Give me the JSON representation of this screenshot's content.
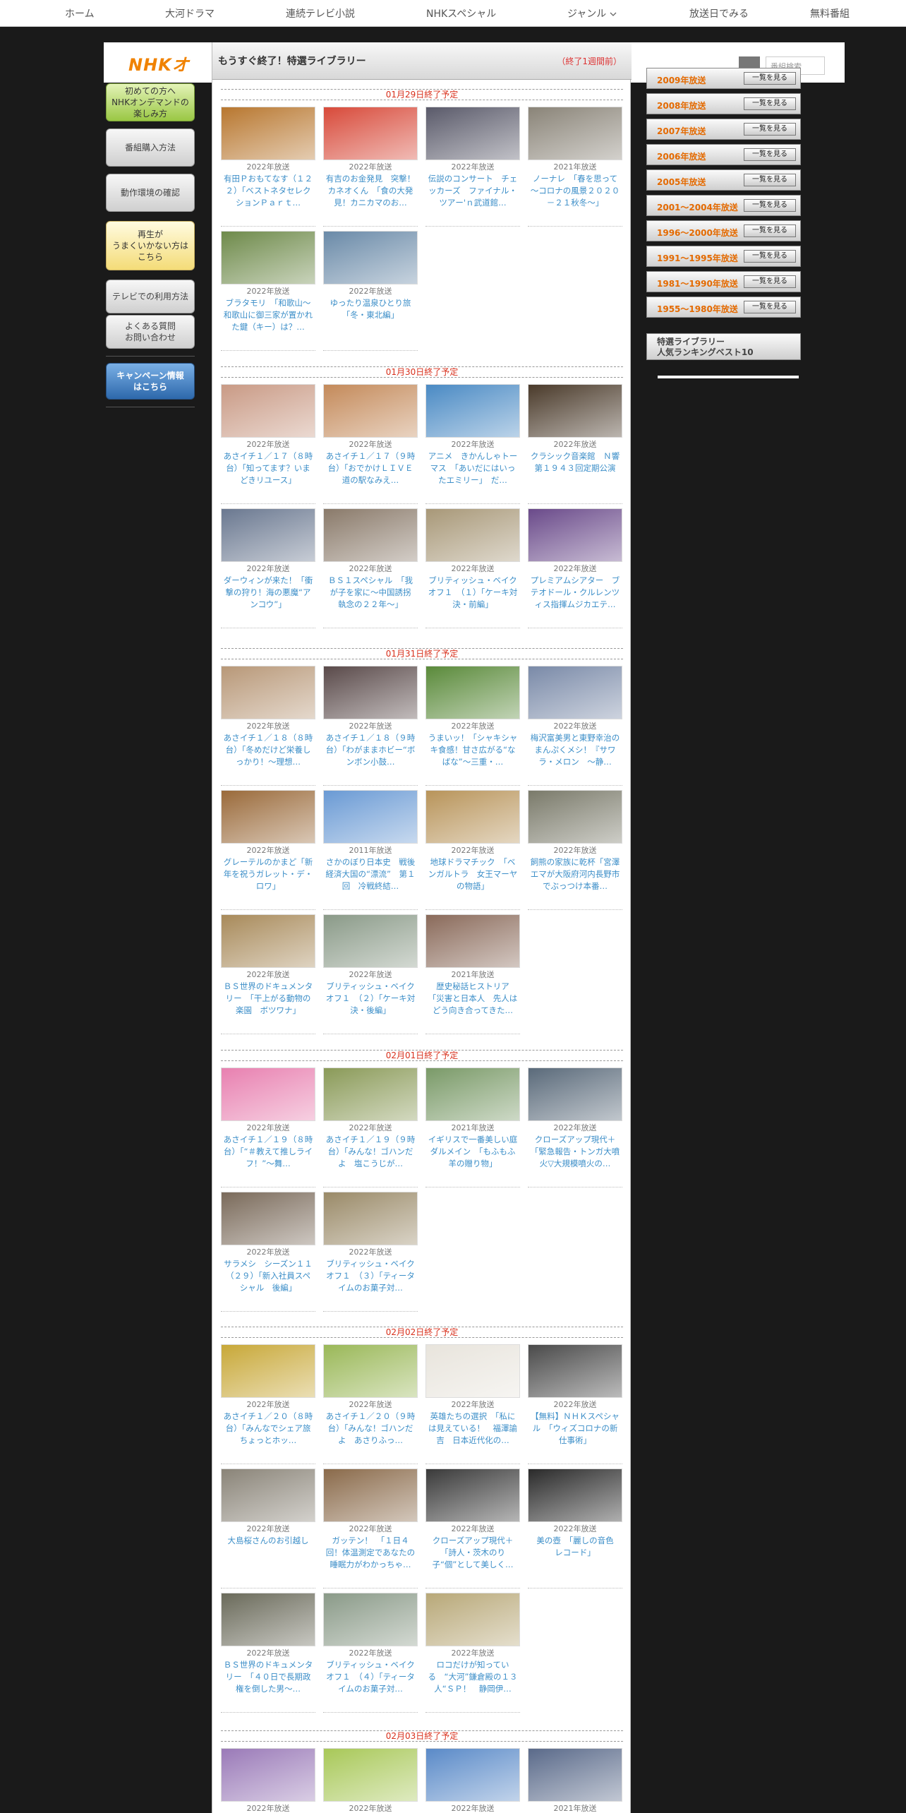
{
  "nav": [
    "ホーム",
    "大河ドラマ",
    "連続テレビ小説",
    "NHKスペシャル",
    "ジャンル",
    "放送日でみる",
    "無料番組"
  ],
  "nav_genre_icon": "chevron-down-icon",
  "header": {
    "logo": "NHKオ",
    "search_placeholder": "番組検索"
  },
  "library": {
    "title": "もうすぐ終了！特選ライブラリー",
    "note": "（終了1週間前）"
  },
  "left": {
    "beginner": "初めての方へ\nNHKオンデマンドの\n楽しみ方",
    "purchase": "番組購入方法",
    "environment": "動作環境の確認",
    "trouble": "再生が\nうまくいかない方は\nこちら",
    "tv": "テレビでの利用方法",
    "faq": "よくある質問\nお問い合わせ",
    "campaign": "キャンペーン情報\nはこちら"
  },
  "right": {
    "view_button": "一覧を見る",
    "years": [
      "2009年放送",
      "2008年放送",
      "2007年放送",
      "2006年放送",
      "2005年放送",
      "2001～2004年放送",
      "1996～2000年放送",
      "1991～1995年放送",
      "1981～1990年放送",
      "1955～1980年放送"
    ],
    "ranking": "特選ライブラリー\n人気ランキングベスト10"
  },
  "sections": [
    {
      "date": "01月29日終了予定",
      "items": [
        {
          "year": "2022年放送",
          "title": "有田Ｐおもてなす（１２２）「ベストネタセレクションＰａｒｔ…",
          "color": "#b8772f"
        },
        {
          "year": "2022年放送",
          "title": "有吉のお金発見　突撃！カネオくん　「食の大発見！カニカマのお…",
          "color": "#d84a3a"
        },
        {
          "year": "2022年放送",
          "title": "伝説のコンサート　チェッカーズ　ファイナル・ツアー'ｎ武道館…",
          "color": "#5a5a6a"
        },
        {
          "year": "2021年放送",
          "title": "ノーナレ　「春を思って～コロナの風景２０２０－２１秋冬～」",
          "color": "#8a8478"
        },
        {
          "year": "2022年放送",
          "title": "ブラタモリ　「和歌山～和歌山に御三家が置かれた鍵（キー）は？…",
          "color": "#6e8a4a"
        },
        {
          "year": "2022年放送",
          "title": "ゆったり温泉ひとり旅　「冬・東北編」",
          "color": "#6a8aa8"
        }
      ]
    },
    {
      "date": "01月30日終了予定",
      "items": [
        {
          "year": "2022年放送",
          "title": "あさイチ１／１７（８時台）「知ってます？いまどきリユース」",
          "color": "#c99a85"
        },
        {
          "year": "2022年放送",
          "title": "あさイチ１／１７（９時台）「おでかけＬＩＶＥ　道の駅なみえ…",
          "color": "#c48a5a"
        },
        {
          "year": "2022年放送",
          "title": "アニメ　きかんしゃトーマス　「あいだにはいったエミリー」　だ…",
          "color": "#4a8ac4"
        },
        {
          "year": "2022年放送",
          "title": "クラシック音楽館　Ｎ響第１９４３回定期公演",
          "color": "#4a3a2a"
        },
        {
          "year": "2022年放送",
          "title": "ダーウィンが来た！「衝撃の狩り！海の悪魔“アンコウ”」",
          "color": "#6a7890"
        },
        {
          "year": "2022年放送",
          "title": "ＢＳ１スペシャル　「我が子を家に～中国誘拐　執念の２２年～」",
          "color": "#8a7a6a"
        },
        {
          "year": "2022年放送",
          "title": "ブリティッシュ・ベイクオフ１　（１）「ケーキ対決・前編」",
          "color": "#a89878"
        },
        {
          "year": "2022年放送",
          "title": "プレミアムシアター　ブテオドール・クルレンツィス指揮ムジカエテ…",
          "color": "#6a4a8a"
        }
      ]
    },
    {
      "date": "01月31日終了予定",
      "items": [
        {
          "year": "2022年放送",
          "title": "あさイチ１／１８（８時台）「冬めだけど栄養しっかり！～理想…",
          "color": "#b89878"
        },
        {
          "year": "2022年放送",
          "title": "あさイチ１／１８（９時台）「わがままホビー“ボンボン小鼓…",
          "color": "#5a4a4a"
        },
        {
          "year": "2022年放送",
          "title": "うまいッ！「シャキシャキ食感！甘さ広がる“なばな”～三重・…",
          "color": "#5a8a3a"
        },
        {
          "year": "2022年放送",
          "title": "梅沢富美男と東野幸治のまんぷくメシ！『サワラ・メロン　～静…",
          "color": "#7a8aa8"
        },
        {
          "year": "2022年放送",
          "title": "グレーテルのかまど「新年を祝うガレット・デ・ロワ」",
          "color": "#9a6a3a"
        },
        {
          "year": "2011年放送",
          "title": "さかのぼり日本史　戦後　経済大国の“漂流”　第１回　冷戦終結…",
          "color": "#6a9ad4"
        },
        {
          "year": "2022年放送",
          "title": "地球ドラマチック　「ベンガルトラ　女王マーヤの物語」",
          "color": "#b8945a"
        },
        {
          "year": "2022年放送",
          "title": "飼熊の家族に乾杯「宮澤エマが大阪府河内長野市でぶっつけ本番…",
          "color": "#7a7a6a"
        },
        {
          "year": "2022年放送",
          "title": "ＢＳ世界のドキュメンタリー　「干上がる動物の楽園　ボツワナ」",
          "color": "#a88a5a"
        },
        {
          "year": "2022年放送",
          "title": "ブリティッシュ・ベイクオフ１　（２）「ケーキ対決・後編」",
          "color": "#8a9a88"
        },
        {
          "year": "2021年放送",
          "title": "歴史秘話ヒストリア　「災害と日本人　先人はどう向き合ってきた…",
          "color": "#8a6a5a"
        }
      ]
    },
    {
      "date": "02月01日終了予定",
      "items": [
        {
          "year": "2022年放送",
          "title": "あさイチ１／１９（８時台）「“＃教えて推しライフ！”～舞…",
          "color": "#e880b0"
        },
        {
          "year": "2022年放送",
          "title": "あさイチ１／１９（９時台）「みんな！ゴハンだよ　塩こうじが…",
          "color": "#8a9a58"
        },
        {
          "year": "2021年放送",
          "title": "イギリスで一番美しい庭　ダルメイン　「もふもふ羊の贈り物」",
          "color": "#7a9a68"
        },
        {
          "year": "2022年放送",
          "title": "クローズアップ現代＋「緊急報告・トンガ大噴火▽大規模噴火の…",
          "color": "#5a6a7a"
        },
        {
          "year": "2022年放送",
          "title": "サラメシ　シーズン１１　（２９）「新入社員スペシャル　後編」",
          "color": "#7a6a5a"
        },
        {
          "year": "2022年放送",
          "title": "ブリティッシュ・ベイクオフ１　（３）「ティータイムのお菓子対…",
          "color": "#9a8a68"
        }
      ]
    },
    {
      "date": "02月02日終了予定",
      "items": [
        {
          "year": "2022年放送",
          "title": "あさイチ１／２０（８時台）「みんなでシェア旅　ちょっとホッ…",
          "color": "#c8a838"
        },
        {
          "year": "2022年放送",
          "title": "あさイチ１／２０（９時台）「みんな！ゴハンだよ　あさりふっ…",
          "color": "#9ab858"
        },
        {
          "year": "2022年放送",
          "title": "英雄たちの選択　「私には見えている！　福澤諭吉　日本近代化の…",
          "color": "#e8e4dc"
        },
        {
          "year": "2022年放送",
          "title": "【無料】ＮＨＫスペシャル　「ウィズコロナの新仕事術」",
          "color": "#4a4a4a"
        },
        {
          "year": "2022年放送",
          "title": "大島桜さんのお引越し",
          "color": "#8a8478"
        },
        {
          "year": "2022年放送",
          "title": "ガッテン！　「１日４回！体温測定であなたの睡眠力がわかっちゃ…",
          "color": "#8a6a4a"
        },
        {
          "year": "2022年放送",
          "title": "クローズアップ現代＋「詩人・茨木のり子“個”として美しく…",
          "color": "#3a3a3a"
        },
        {
          "year": "2022年放送",
          "title": "美の壺　「麗しの音色　レコード」",
          "color": "#2a2a2a"
        },
        {
          "year": "2022年放送",
          "title": "ＢＳ世界のドキュメンタリー　「４０日で長期政権を倒した男～…",
          "color": "#6a6a5a"
        },
        {
          "year": "2022年放送",
          "title": "ブリティッシュ・ベイクオフ１　（４）「ティータイムのお菓子対…",
          "color": "#8a9a88"
        },
        {
          "year": "2022年放送",
          "title": "ロコだけが知っている　“大河”鎌倉殿の１３人“ＳＰ！　静岡伊…",
          "color": "#b8a878"
        }
      ]
    },
    {
      "date": "02月03日終了予定",
      "items": [
        {
          "year": "2022年放送",
          "title": "",
          "color": "#9a7ab8"
        },
        {
          "year": "2022年放送",
          "title": "",
          "color": "#a8c858"
        },
        {
          "year": "2022年放送",
          "title": "",
          "color": "#5a8ac8"
        },
        {
          "year": "2021年放送",
          "title": "",
          "color": "#5a6a8a"
        }
      ]
    }
  ]
}
